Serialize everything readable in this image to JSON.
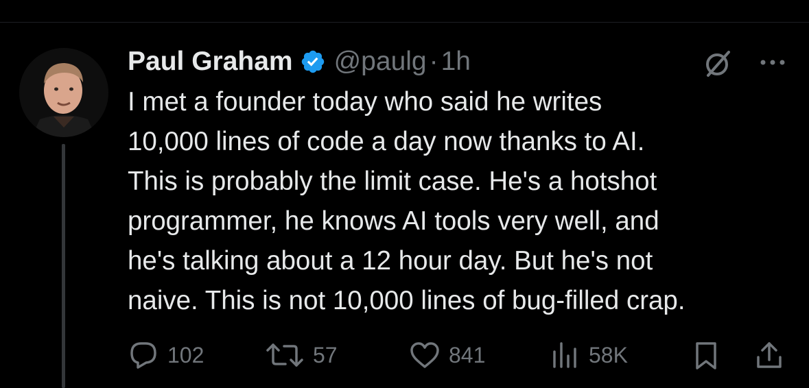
{
  "tweet": {
    "display_name": "Paul Graham",
    "handle": "@paulg",
    "separator": "·",
    "time": "1h",
    "text_lines": [
      "I met a founder today who said he writes",
      "10,000 lines of code a day now thanks to AI.",
      "This is probably the limit case. He's a hotshot",
      "programmer, he knows AI tools very well, and",
      "he's talking about a 12 hour day. But he's not",
      "naive. This is not 10,000 lines of bug-filled crap."
    ]
  },
  "actions": {
    "replies": "102",
    "reposts": "57",
    "likes": "841",
    "views": "58K"
  },
  "icons": {
    "verified": "verified-badge-icon",
    "grok": "grok-icon",
    "more": "more-icon",
    "reply": "reply-icon",
    "repost": "repost-icon",
    "like": "heart-icon",
    "views": "views-icon",
    "bookmark": "bookmark-icon",
    "share": "share-icon"
  },
  "colors": {
    "background": "#000000",
    "text": "#e7e9ea",
    "secondary": "#71767b",
    "verified": "#1d9bf0"
  }
}
